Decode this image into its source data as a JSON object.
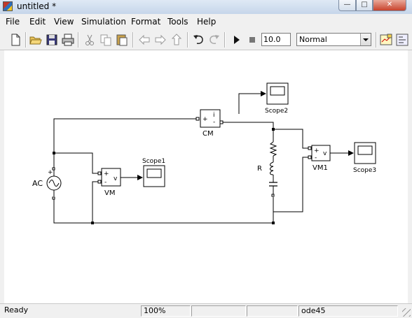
{
  "window": {
    "title": "untitled *"
  },
  "menu": [
    "File",
    "Edit",
    "View",
    "Simulation",
    "Format",
    "Tools",
    "Help"
  ],
  "toolbar": {
    "stop_time": "10.0",
    "sim_mode": "Normal"
  },
  "model": {
    "ac_label": "AC",
    "vm_label": "VM",
    "vm1_label": "VM1",
    "cm_label": "CM",
    "r_label": "R",
    "scope1_label": "Scope1",
    "scope2_label": "Scope2",
    "scope3_label": "Scope3",
    "vm_port": "v",
    "vm1_port": "v",
    "cm_port": "i",
    "plus": "+",
    "minus": "-"
  },
  "status": {
    "ready": "Ready",
    "zoom": "100%",
    "solver": "ode45"
  }
}
